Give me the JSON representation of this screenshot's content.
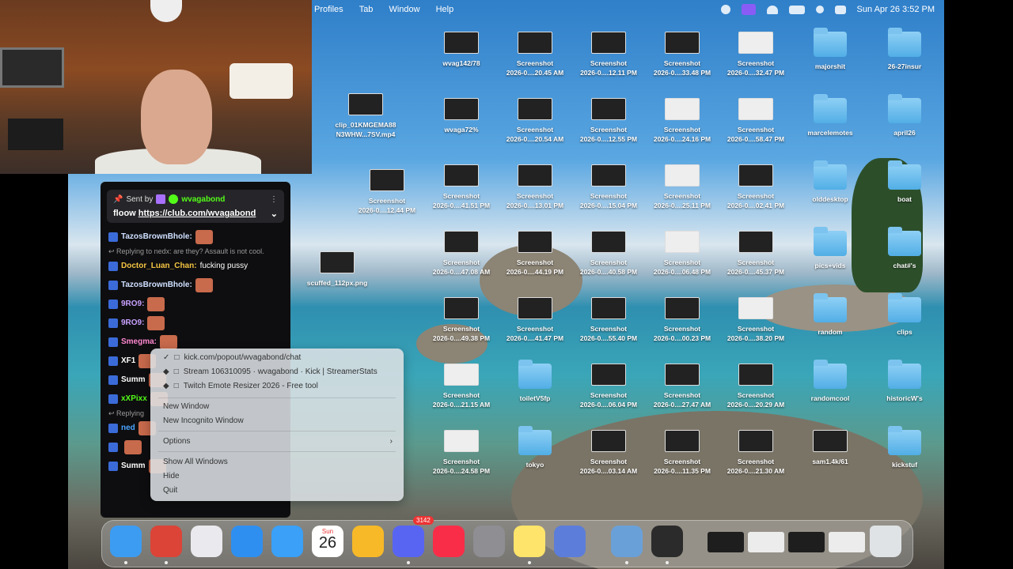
{
  "menubar": {
    "items": [
      "Profiles",
      "Tab",
      "Window",
      "Help"
    ],
    "datetime": "Sun Apr 26  3:52 PM"
  },
  "chat": {
    "pinned": {
      "sent_by_label": "Sent by",
      "sender": "wvagabond",
      "message_prefix": "floow ",
      "link": "https://club.com/wvagabond"
    },
    "messages": [
      {
        "user": "TazosBrownBhole:",
        "text": "",
        "color": "#cfe0ff"
      },
      {
        "reply": "Replying to nedx: are they? Assault is not cool."
      },
      {
        "user": "Doctor_Luan_Chan:",
        "text": "fucking pussy",
        "color": "#f5c542"
      },
      {
        "user": "TazosBrownBhole:",
        "text": "",
        "color": "#cfe0ff"
      },
      {
        "user": "9RO9:",
        "text": "",
        "color": "#c9a0ff"
      },
      {
        "user": "9RO9:",
        "text": "",
        "color": "#c9a0ff"
      },
      {
        "user": "Smegma:",
        "text": "",
        "color": "#ff88d0"
      },
      {
        "user": "XF1",
        "text": "",
        "color": "#ffffff"
      },
      {
        "user": "Summ",
        "text": "",
        "color": "#ffffff"
      },
      {
        "user": "xXPixx",
        "text": "",
        "color": "#53fc18"
      },
      {
        "reply": "Replying"
      },
      {
        "user": "ned",
        "text": "",
        "color": "#4aa3ff"
      },
      {
        "user": "",
        "text": "",
        "color": "#ffffff"
      },
      {
        "user": "Summ",
        "text": "",
        "color": "#ffffff"
      }
    ]
  },
  "context_menu": {
    "windows": [
      "kick.com/popout/wvagabond/chat",
      "Stream 106310095 · wvagabond · Kick | StreamerStats",
      "Twitch Emote Resizer 2026 - Free tool"
    ],
    "new_window": "New Window",
    "new_incognito": "New Incognito Window",
    "options": "Options",
    "show_all": "Show All Windows",
    "hide": "Hide",
    "quit": "Quit"
  },
  "desktop": {
    "items": [
      {
        "label": "wvag142/78",
        "kind": "thumb"
      },
      {
        "label": "Screenshot\n2026-0....20.45 AM",
        "kind": "thumb"
      },
      {
        "label": "Screenshot\n2026-0....12.11 PM",
        "kind": "thumb"
      },
      {
        "label": "Screenshot\n2026-0....33.48 PM",
        "kind": "thumb"
      },
      {
        "label": "Screenshot\n2026-0....32.47 PM",
        "kind": "thumbw"
      },
      {
        "label": "majorshit",
        "kind": "folder"
      },
      {
        "label": "26-27insur",
        "kind": "folder"
      },
      {
        "label": "clip_01KMGEMA88\nN3WHW...7SV.mp4",
        "kind": "thumb"
      },
      {
        "label": "wvaga72%",
        "kind": "thumb"
      },
      {
        "label": "Screenshot\n2026-0....20.54 AM",
        "kind": "thumb"
      },
      {
        "label": "Screenshot\n2026-0....12.55 PM",
        "kind": "thumb"
      },
      {
        "label": "Screenshot\n2026-0....24.16 PM",
        "kind": "thumbw"
      },
      {
        "label": "Screenshot\n2026-0....58.47 PM",
        "kind": "thumbw"
      },
      {
        "label": "marcelemotes",
        "kind": "folder"
      },
      {
        "label": "april26",
        "kind": "folder"
      },
      {
        "label": "Screenshot\n2026-0....12.44 PM",
        "kind": "thumb"
      },
      {
        "label": "Screenshot\n2026-0....41.51 PM",
        "kind": "thumb"
      },
      {
        "label": "Screenshot\n2026-0....13.01 PM",
        "kind": "thumb"
      },
      {
        "label": "Screenshot\n2026-0....15.04 PM",
        "kind": "thumb"
      },
      {
        "label": "Screenshot\n2026-0....25.11 PM",
        "kind": "thumbw"
      },
      {
        "label": "Screenshot\n2026-0....02.41 PM",
        "kind": "thumb"
      },
      {
        "label": "olddesktop",
        "kind": "folder"
      },
      {
        "label": "boat",
        "kind": "folder"
      },
      {
        "label": "scuffed_112px.png",
        "kind": "thumb"
      },
      {
        "label": "Screenshot\n2026-0....47.08 AM",
        "kind": "thumb"
      },
      {
        "label": "Screenshot\n2026-0....44.19 PM",
        "kind": "thumb"
      },
      {
        "label": "Screenshot\n2026-0....40.58 PM",
        "kind": "thumb"
      },
      {
        "label": "Screenshot\n2026-0....06.48 PM",
        "kind": "thumbw"
      },
      {
        "label": "Screenshot\n2026-0....45.37 PM",
        "kind": "thumb"
      },
      {
        "label": "pics+vids",
        "kind": "folder"
      },
      {
        "label": "chat#'s",
        "kind": "folder"
      },
      {
        "label": "Screenshot\n2026-0....49.38 PM",
        "kind": "thumb"
      },
      {
        "label": "Screenshot\n2026-0....41.47 PM",
        "kind": "thumb"
      },
      {
        "label": "Screenshot\n2026-0....55.40 PM",
        "kind": "thumb"
      },
      {
        "label": "Screenshot\n2026-0....00.23 PM",
        "kind": "thumb"
      },
      {
        "label": "Screenshot\n2026-0....38.20 PM",
        "kind": "thumbw"
      },
      {
        "label": "random",
        "kind": "folder"
      },
      {
        "label": "clips",
        "kind": "folder"
      },
      {
        "label": "Screenshot\n2026-0....21.15 AM",
        "kind": "thumbw"
      },
      {
        "label": "toiletV5fp",
        "kind": "folder"
      },
      {
        "label": "Screenshot\n2026-0....06.04 PM",
        "kind": "thumb"
      },
      {
        "label": "Screenshot\n2026-0....27.47 AM",
        "kind": "thumb"
      },
      {
        "label": "Screenshot\n2026-0....20.29 AM",
        "kind": "thumb"
      },
      {
        "label": "randomcool",
        "kind": "folder"
      },
      {
        "label": "historicW's",
        "kind": "folder"
      },
      {
        "label": "Screenshot\n2026-0....24.58 PM",
        "kind": "thumbw"
      },
      {
        "label": "tokyo",
        "kind": "folder"
      },
      {
        "label": "Screenshot\n2026-0....03.14 AM",
        "kind": "thumb"
      },
      {
        "label": "Screenshot\n2026-0....11.35 PM",
        "kind": "thumb"
      },
      {
        "label": "Screenshot\n2026-0....21.30 AM",
        "kind": "thumb"
      },
      {
        "label": "sam1.4k/61",
        "kind": "thumb"
      },
      {
        "label": "kickstuf",
        "kind": "folder"
      }
    ]
  },
  "dock": {
    "calendar_month": "Sun",
    "calendar_day": "26",
    "discord_badge": "3142",
    "apps": [
      {
        "name": "finder-icon",
        "color": "#3c9cf2"
      },
      {
        "name": "chrome-icon",
        "color": "#db4437"
      },
      {
        "name": "launchpad-icon",
        "color": "#e9e9ee"
      },
      {
        "name": "safari-icon",
        "color": "#2f8ff0"
      },
      {
        "name": "mail-icon",
        "color": "#3aa0f8"
      },
      {
        "name": "calendar-icon",
        "color": "#ffffff"
      },
      {
        "name": "photos-icon",
        "color": "#f7b928"
      },
      {
        "name": "discord-icon",
        "color": "#5865f2"
      },
      {
        "name": "music-icon",
        "color": "#fa2d48"
      },
      {
        "name": "settings-icon",
        "color": "#8e8e93"
      },
      {
        "name": "notes-icon",
        "color": "#ffe46b"
      },
      {
        "name": "iphone-mirroring-icon",
        "color": "#5c7dd9"
      },
      {
        "name": "preview-icon",
        "color": "#6aa0d8"
      },
      {
        "name": "obs-icon",
        "color": "#2b2b2b"
      }
    ]
  }
}
